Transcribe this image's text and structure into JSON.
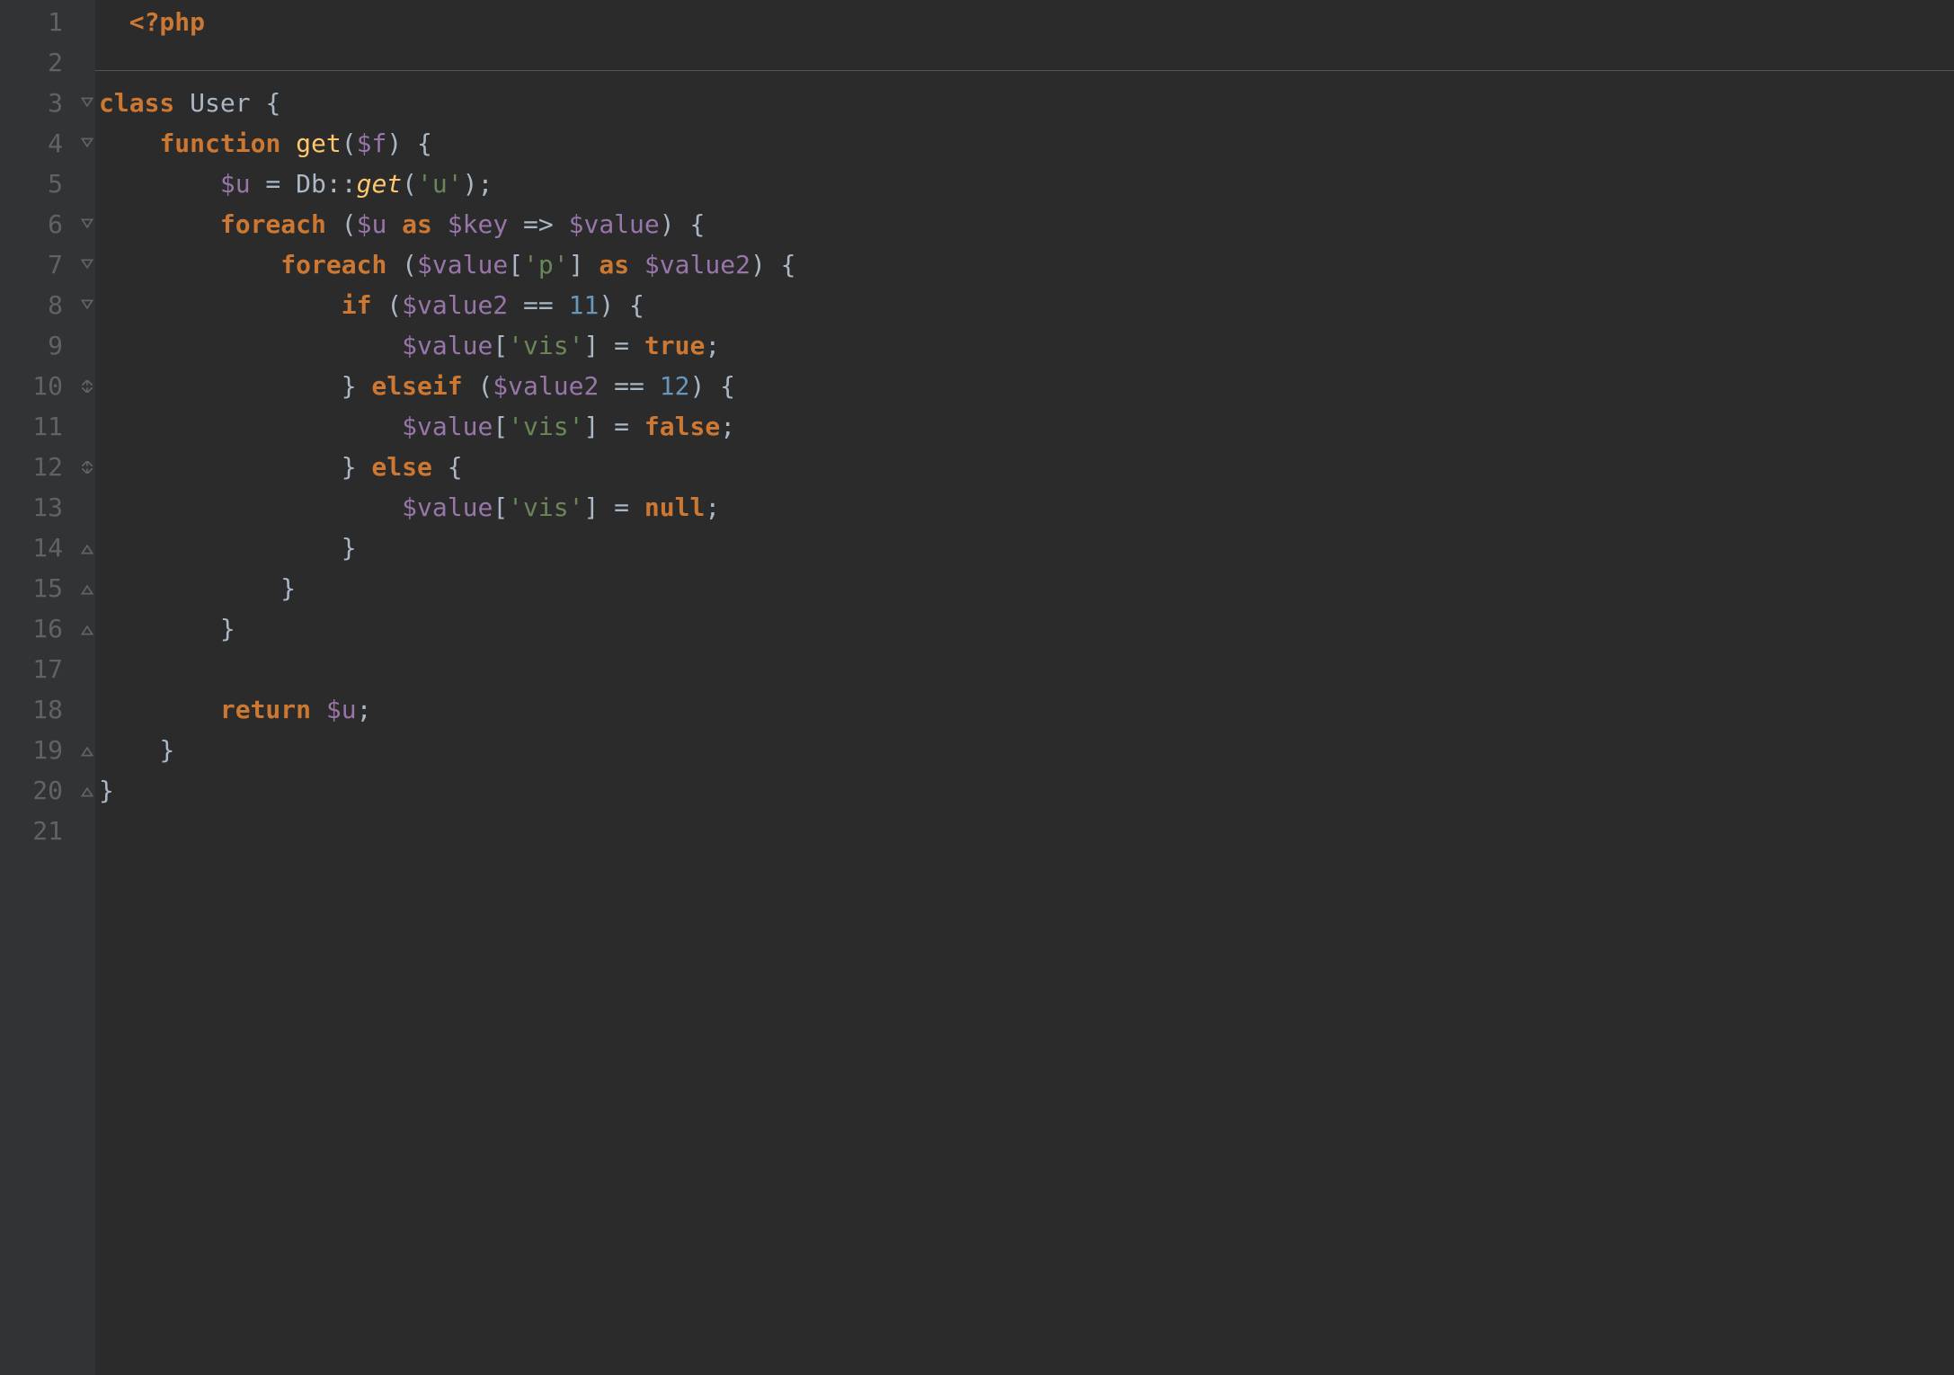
{
  "lineNumbers": [
    "1",
    "2",
    "3",
    "4",
    "5",
    "6",
    "7",
    "8",
    "9",
    "10",
    "11",
    "12",
    "13",
    "14",
    "15",
    "16",
    "17",
    "18",
    "19",
    "20",
    "21"
  ],
  "foldMarkers": {
    "3": "open-start",
    "4": "open-start",
    "6": "open-start",
    "7": "open-start",
    "8": "open-start",
    "10": "close-mid",
    "12": "close-mid",
    "14": "close",
    "15": "close",
    "16": "close",
    "19": "close",
    "20": "close"
  },
  "code": {
    "l1": {
      "phpOpen": "<?php"
    },
    "l3": {
      "k_class": "class",
      "cls": "User",
      "brace": " {"
    },
    "l4": {
      "k_func": "function",
      "fn": "get",
      "open": "(",
      "var": "$f",
      "close": ") {"
    },
    "l5": {
      "var_u": "$u",
      "eq": " = ",
      "cls_db": "Db",
      "scope": "::",
      "fn_get": "get",
      "open": "(",
      "str": "'u'",
      "close": ");"
    },
    "l6": {
      "k_foreach": "foreach",
      "open": " (",
      "var_u": "$u",
      "k_as": " as ",
      "var_key": "$key",
      "arrow": " => ",
      "var_val": "$value",
      "close": ") {"
    },
    "l7": {
      "k_foreach": "foreach",
      "open": " (",
      "var_val": "$value",
      "bracket_open": "[",
      "str": "'p'",
      "bracket_close": "]",
      "k_as": " as ",
      "var_val2": "$value2",
      "close": ") {"
    },
    "l8": {
      "k_if": "if",
      "open": " (",
      "var_val2": "$value2",
      "eq": " == ",
      "num": "11",
      "close": ") {"
    },
    "l9": {
      "var_val": "$value",
      "bracket_open": "[",
      "str": "'vis'",
      "bracket_close": "]",
      "eq": " = ",
      "k_true": "true",
      "semi": ";"
    },
    "l10": {
      "brace_close": "}",
      "k_elseif": " elseif ",
      "open": "(",
      "var_val2": "$value2",
      "eq": " == ",
      "num": "12",
      "close": ") {"
    },
    "l11": {
      "var_val": "$value",
      "bracket_open": "[",
      "str": "'vis'",
      "bracket_close": "]",
      "eq": " = ",
      "k_false": "false",
      "semi": ";"
    },
    "l12": {
      "brace_close": "}",
      "k_else": " else ",
      "brace_open": "{"
    },
    "l13": {
      "var_val": "$value",
      "bracket_open": "[",
      "str": "'vis'",
      "bracket_close": "]",
      "eq": " = ",
      "k_null": "null",
      "semi": ";"
    },
    "l14": {
      "brace_close": "}"
    },
    "l15": {
      "brace_close": "}"
    },
    "l16": {
      "brace_close": "}"
    },
    "l18": {
      "k_return": "return",
      "var_u": " $u",
      "semi": ";"
    },
    "l19": {
      "brace_close": "}"
    },
    "l20": {
      "brace_close": "}"
    }
  }
}
